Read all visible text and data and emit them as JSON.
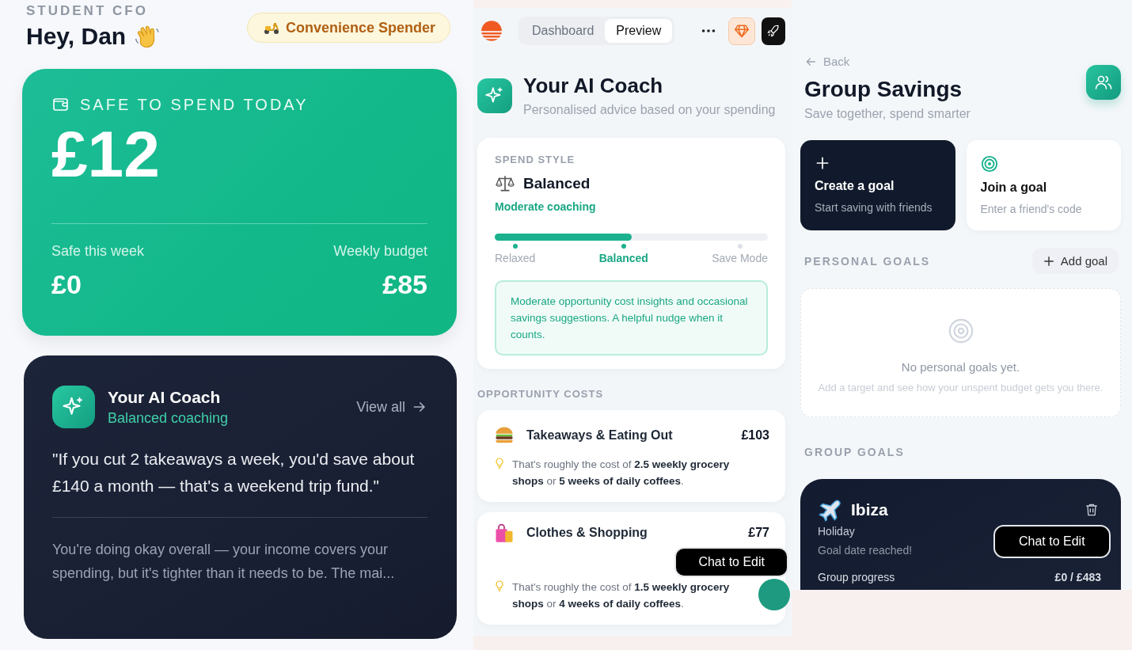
{
  "home": {
    "eyebrow": "STUDENT CFO",
    "greeting": "Hey, Dan",
    "badge": "Convenience Spender",
    "safe_card": {
      "label": "SAFE TO SPEND TODAY",
      "amount": "£12",
      "stats": [
        {
          "label": "Safe this week",
          "value": "£0"
        },
        {
          "label": "Weekly budget",
          "value": "£85"
        }
      ]
    },
    "coach_card": {
      "title": "Your AI Coach",
      "subtitle": "Balanced coaching",
      "link": "View all",
      "quote": "\"If you cut 2 takeaways a week, you'd save about £140 a month — that's a weekend trip fund.\"",
      "summary": "You're doing okay overall — your income covers your spending, but it's tighter than it needs to be. The mai..."
    }
  },
  "coach": {
    "tabs": [
      {
        "label": "Dashboard",
        "selected": false
      },
      {
        "label": "Preview",
        "selected": true
      }
    ],
    "title": "Your AI Coach",
    "subtitle": "Personalised advice based on your spending",
    "spend_style": {
      "label": "SPEND STYLE",
      "name": "Balanced",
      "coaching": "Moderate coaching",
      "level": 0.5,
      "steps": [
        {
          "label": "Relaxed",
          "selected": false
        },
        {
          "label": "Balanced",
          "selected": true
        },
        {
          "label": "Save Mode",
          "selected": false
        }
      ],
      "note": "Moderate opportunity cost insights and occasional savings suggestions. A helpful nudge when it counts."
    },
    "section": "OPPORTUNITY COSTS",
    "costs": [
      {
        "kind": "food",
        "category": "Takeaways & Eating Out",
        "amount": "£103",
        "tip": "That's roughly the cost of **2.5 weekly grocery shops** or **5 weeks of daily coffees**."
      },
      {
        "kind": "shopping",
        "category": "Clothes & Shopping",
        "amount": "£77",
        "tip": "That's roughly the cost of **1.5 weekly grocery shops** or **4 weeks of daily coffees**."
      }
    ],
    "chat_button": "Chat to Edit"
  },
  "savings": {
    "back": "Back",
    "title": "Group Savings",
    "subtitle": "Save together, spend smarter",
    "actions": [
      {
        "kind": "create",
        "title": "Create a goal",
        "subtitle": "Start saving with friends"
      },
      {
        "kind": "join",
        "title": "Join a goal",
        "subtitle": "Enter a friend's code"
      }
    ],
    "personal": {
      "heading": "PERSONAL GOALS",
      "add": "Add goal",
      "empty_title": "No personal goals yet.",
      "empty_text": "Add a target and see how your unspent budget gets you there."
    },
    "group": {
      "heading": "GROUP GOALS",
      "goals": [
        {
          "kind": "travel",
          "name": "Ibiza",
          "category": "Holiday",
          "status": "Goal date reached!",
          "progress_label": "Group progress",
          "progress": "£0 / £483"
        }
      ]
    },
    "chat_button": "Chat to Edit"
  }
}
